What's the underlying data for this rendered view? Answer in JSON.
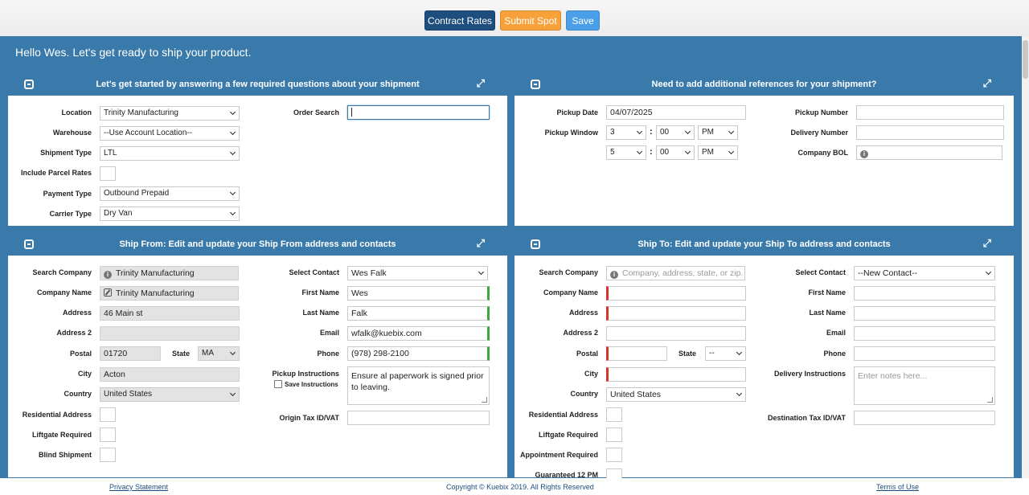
{
  "toolbar": {
    "contract_rates": "Contract Rates",
    "submit_spot": "Submit Spot",
    "save": "Save"
  },
  "greeting": "Hello Wes. Let's get ready to ship your product.",
  "panels": {
    "required": {
      "title": "Let's get started by answering a few required questions about your shipment",
      "location_label": "Location",
      "location_value": "Trinity Manufacturing",
      "warehouse_label": "Warehouse",
      "warehouse_value": "--Use Account Location--",
      "shipment_type_label": "Shipment Type",
      "shipment_type_value": "LTL",
      "parcel_label": "Include Parcel Rates",
      "payment_label": "Payment Type",
      "payment_value": "Outbound Prepaid",
      "carrier_label": "Carrier Type",
      "carrier_value": "Dry Van",
      "order_search_label": "Order Search",
      "order_search_value": ""
    },
    "references": {
      "title": "Need to add additional references for your shipment?",
      "pickup_date_label": "Pickup Date",
      "pickup_date_value": "04/07/2025",
      "pickup_window_label": "Pickup Window",
      "window_start": {
        "hour": "3",
        "minute": "00",
        "ampm": "PM"
      },
      "window_end": {
        "hour": "5",
        "minute": "00",
        "ampm": "PM"
      },
      "pickup_number_label": "Pickup Number",
      "delivery_number_label": "Delivery Number",
      "company_bol_label": "Company BOL"
    },
    "ship_from": {
      "title": "Ship From: Edit and update your Ship From address and contacts",
      "search_company_label": "Search Company",
      "search_company_value": "Trinity Manufacturing",
      "company_name_label": "Company Name",
      "company_name_value": "Trinity Manufacturing",
      "address_label": "Address",
      "address_value": "46 Main st",
      "address2_label": "Address 2",
      "address2_value": "",
      "postal_label": "Postal",
      "postal_value": "01720",
      "state_label": "State",
      "state_value": "MA",
      "city_label": "City",
      "city_value": "Acton",
      "country_label": "Country",
      "country_value": "United States",
      "residential_label": "Residential Address",
      "liftgate_label": "Liftgate Required",
      "blind_label": "Blind Shipment",
      "select_contact_label": "Select Contact",
      "select_contact_value": "Wes Falk",
      "first_name_label": "First Name",
      "first_name_value": "Wes",
      "last_name_label": "Last Name",
      "last_name_value": "Falk",
      "email_label": "Email",
      "email_value": "wfalk@kuebix.com",
      "phone_label": "Phone",
      "phone_value": "(978) 298-2100",
      "pickup_instr_label": "Pickup Instructions",
      "save_instr_label": "Save Instructions",
      "pickup_instr_value": "Ensure al paperwork is signed prior to leaving.",
      "origin_tax_label": "Origin Tax ID/VAT"
    },
    "ship_to": {
      "title": "Ship To: Edit and update your Ship To address and contacts",
      "search_company_label": "Search Company",
      "search_company_placeholder": "Company, address, state, or zip.",
      "company_name_label": "Company Name",
      "address_label": "Address",
      "address2_label": "Address 2",
      "postal_label": "Postal",
      "state_label": "State",
      "state_value": "--",
      "city_label": "City",
      "country_label": "Country",
      "country_value": "United States",
      "residential_label": "Residential Address",
      "liftgate_label": "Liftgate Required",
      "appointment_label": "Appointment Required",
      "guaranteed_label": "Guaranteed 12 PM",
      "select_contact_label": "Select Contact",
      "select_contact_value": "--New Contact--",
      "first_name_label": "First Name",
      "last_name_label": "Last Name",
      "email_label": "Email",
      "phone_label": "Phone",
      "delivery_instr_label": "Delivery Instructions",
      "delivery_instr_placeholder": "Enter notes here...",
      "dest_tax_label": "Destination Tax ID/VAT"
    }
  },
  "footer": {
    "privacy": "Privacy Statement",
    "copyright": "Copyright © Kuebix 2019. All Rights Reserved",
    "terms": "Terms of Use"
  }
}
